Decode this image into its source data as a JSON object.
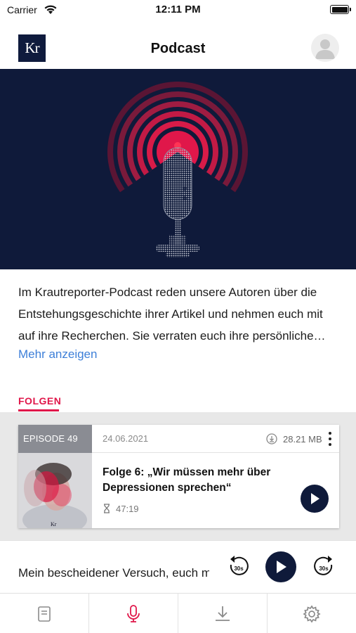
{
  "status_bar": {
    "carrier": "Carrier",
    "time": "12:11 PM",
    "icons": [
      "wifi-icon",
      "battery-icon"
    ]
  },
  "nav": {
    "logo_text": "Kr",
    "title": "Podcast",
    "avatar_icon": "user-avatar-icon"
  },
  "hero": {
    "image": "microphone-illustration",
    "background_color": "#0f1a3a",
    "accent_color": "#e0174a"
  },
  "description": {
    "text": "Im Krautreporter-Podcast reden unsere Autoren über die Entstehungsgeschichte ihrer Artikel und nehmen euch mit auf ihre Recherchen. Sie verraten euch ihre persönliche Perspektive",
    "more_label": "Mehr anzeigen"
  },
  "section": {
    "title": "FOLGEN"
  },
  "episodes": [
    {
      "badge": "EPISODE 49",
      "date": "24.06.2021",
      "size": "28.21 MB",
      "title": "Folge 6: „Wir müssen mehr über Depressionen sprechen“",
      "duration": "47:19",
      "thumb_text": "Kr"
    }
  ],
  "player": {
    "now_playing": "Mein bescheidener Versuch, euch mi",
    "skip_back_label": "30s",
    "skip_forward_label": "30s"
  },
  "tabs": [
    {
      "icon": "article-icon",
      "active": false
    },
    {
      "icon": "microphone-icon",
      "active": true
    },
    {
      "icon": "download-icon",
      "active": false
    },
    {
      "icon": "settings-gear-icon",
      "active": false
    }
  ],
  "colors": {
    "brand_navy": "#0f1a3a",
    "accent_red": "#e0174a",
    "link_blue": "#3d7fd8"
  }
}
